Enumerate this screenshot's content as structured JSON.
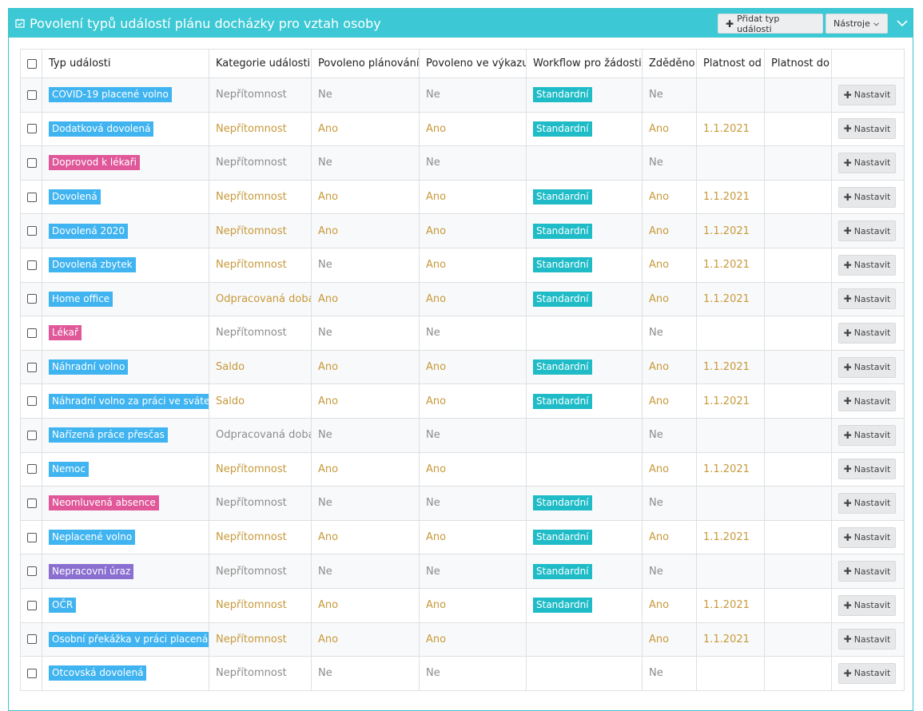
{
  "panel": {
    "title": "Povolení typů událostí plánu docházky pro vztah osoby",
    "add_button": "Přidat typ události",
    "tools_button": "Nástroje",
    "accent": "#3cc8d4"
  },
  "table": {
    "columns": [
      "Typ události",
      "Kategorie události",
      "Povoleno plánování",
      "Povoleno ve výkazu",
      "Workflow pro žádosti",
      "Zděděno",
      "Platnost od",
      "Platnost do"
    ],
    "set_label": "Nastavit",
    "rows": [
      {
        "type": "COVID-19 placené volno",
        "color": "#40b4f0",
        "category": "Nepřítomnost",
        "planning": "Ne",
        "report": "Ne",
        "workflow": "Standardní",
        "inherited": "Ne",
        "from": "",
        "to": ""
      },
      {
        "type": "Dodatková dovolená",
        "color": "#40b4f0",
        "category": "Nepřítomnost",
        "planning": "Ano",
        "report": "Ano",
        "workflow": "Standardní",
        "inherited": "Ano",
        "from": "1.1.2021",
        "to": ""
      },
      {
        "type": "Doprovod k lékaři",
        "color": "#e0589a",
        "category": "Nepřítomnost",
        "planning": "Ne",
        "report": "Ne",
        "workflow": "",
        "inherited": "Ne",
        "from": "",
        "to": ""
      },
      {
        "type": "Dovolená",
        "color": "#40b4f0",
        "category": "Nepřítomnost",
        "planning": "Ano",
        "report": "Ano",
        "workflow": "Standardní",
        "inherited": "Ano",
        "from": "1.1.2021",
        "to": ""
      },
      {
        "type": "Dovolená 2020",
        "color": "#40b4f0",
        "category": "Nepřítomnost",
        "planning": "Ano",
        "report": "Ano",
        "workflow": "Standardní",
        "inherited": "Ano",
        "from": "1.1.2021",
        "to": ""
      },
      {
        "type": "Dovolená zbytek",
        "color": "#40b4f0",
        "category": "Nepřítomnost",
        "planning": "Ne",
        "report": "Ano",
        "workflow": "Standardní",
        "inherited": "Ano",
        "from": "1.1.2021",
        "to": ""
      },
      {
        "type": "Home office",
        "color": "#40b4f0",
        "category": "Odpracovaná doba",
        "planning": "Ano",
        "report": "Ano",
        "workflow": "Standardní",
        "inherited": "Ano",
        "from": "1.1.2021",
        "to": ""
      },
      {
        "type": "Lékař",
        "color": "#e0589a",
        "category": "Nepřítomnost",
        "planning": "Ne",
        "report": "Ne",
        "workflow": "",
        "inherited": "Ne",
        "from": "",
        "to": ""
      },
      {
        "type": "Náhradní volno",
        "color": "#40b4f0",
        "category": "Saldo",
        "planning": "Ano",
        "report": "Ano",
        "workflow": "Standardní",
        "inherited": "Ano",
        "from": "1.1.2021",
        "to": ""
      },
      {
        "type": "Náhradní volno za práci ve svátek",
        "color": "#40b4f0",
        "category": "Saldo",
        "planning": "Ano",
        "report": "Ano",
        "workflow": "Standardní",
        "inherited": "Ano",
        "from": "1.1.2021",
        "to": ""
      },
      {
        "type": "Nařízená práce přesčas",
        "color": "#40b4f0",
        "category": "Odpracovaná doba",
        "planning": "Ne",
        "report": "Ne",
        "workflow": "",
        "inherited": "Ne",
        "from": "",
        "to": ""
      },
      {
        "type": "Nemoc",
        "color": "#40b4f0",
        "category": "Nepřítomnost",
        "planning": "Ano",
        "report": "Ano",
        "workflow": "",
        "inherited": "Ano",
        "from": "1.1.2021",
        "to": ""
      },
      {
        "type": "Neomluvená absence",
        "color": "#e0589a",
        "category": "Nepřítomnost",
        "planning": "Ne",
        "report": "Ne",
        "workflow": "Standardní",
        "inherited": "Ne",
        "from": "",
        "to": ""
      },
      {
        "type": "Neplacené volno",
        "color": "#40b4f0",
        "category": "Nepřítomnost",
        "planning": "Ano",
        "report": "Ano",
        "workflow": "Standardní",
        "inherited": "Ano",
        "from": "1.1.2021",
        "to": ""
      },
      {
        "type": "Nepracovní úraz",
        "color": "#8a6fd1",
        "category": "Nepřítomnost",
        "planning": "Ne",
        "report": "Ne",
        "workflow": "Standardní",
        "inherited": "Ne",
        "from": "",
        "to": ""
      },
      {
        "type": "OČR",
        "color": "#40b4f0",
        "category": "Nepřítomnost",
        "planning": "Ano",
        "report": "Ano",
        "workflow": "Standardní",
        "inherited": "Ano",
        "from": "1.1.2021",
        "to": ""
      },
      {
        "type": "Osobní překážka v práci placená",
        "color": "#40b4f0",
        "category": "Nepřítomnost",
        "planning": "Ano",
        "report": "Ano",
        "workflow": "",
        "inherited": "Ano",
        "from": "1.1.2021",
        "to": ""
      },
      {
        "type": "Otcovská dovolená",
        "color": "#40b4f0",
        "category": "Nepřítomnost",
        "planning": "Ne",
        "report": "Ne",
        "workflow": "",
        "inherited": "Ne",
        "from": "",
        "to": ""
      }
    ]
  }
}
